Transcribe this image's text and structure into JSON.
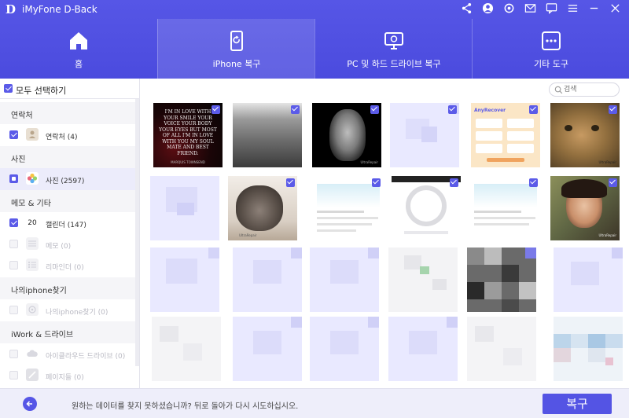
{
  "app": {
    "logo": "D",
    "title": "iMyFone D-Back"
  },
  "titlebar_icons": [
    "share-icon",
    "account-icon",
    "settings-icon",
    "mail-icon",
    "feedback-icon",
    "menu-icon",
    "minimize-icon",
    "close-icon"
  ],
  "nav": {
    "tabs": [
      {
        "label": "홈",
        "icon": "home-icon",
        "active": false
      },
      {
        "label": "iPhone 복구",
        "icon": "phone-recovery-icon",
        "active": true
      },
      {
        "label": "PC 및 하드 드라이브 복구",
        "icon": "pc-recovery-icon",
        "active": false
      },
      {
        "label": "기타 도구",
        "icon": "more-tools-icon",
        "active": false
      }
    ]
  },
  "sidebar": {
    "select_all": "모두 선택하기",
    "categories": [
      {
        "title": "연락처",
        "items": [
          {
            "label": "연락처 (4)",
            "state": "checked"
          }
        ]
      },
      {
        "title": "사진",
        "items": [
          {
            "label": "사진 (2597)",
            "state": "partial"
          }
        ]
      },
      {
        "title": "메모 & 기타",
        "items": [
          {
            "label": "캘린더 (147)",
            "state": "checked",
            "icon_text": "20"
          },
          {
            "label": "메모 (0)",
            "state": "disabled"
          },
          {
            "label": "리마인더 (0)",
            "state": "disabled"
          }
        ]
      },
      {
        "title": "나의iphone찾기",
        "items": [
          {
            "label": "나의iphone찾기 (0)",
            "state": "disabled"
          }
        ]
      },
      {
        "title": "iWork & 드라이브",
        "items": [
          {
            "label": "아이클라우드 드라이브 (0)",
            "state": "disabled"
          },
          {
            "label": "페이지들 (0)",
            "state": "disabled"
          }
        ]
      }
    ]
  },
  "search": {
    "placeholder": "검색"
  },
  "photos": {
    "poster_text": "I'M IN LOVE WITH YOUR SMILE YOUR VOICE YOUR BODY YOUR EYES BUT MOST OF ALL I'M IN LOVE WITH YOU MY SOUL MATE AND BEST FRIEND.",
    "poster_sub": "MARQUIS TOWNSEND",
    "watermark": "UltraRepair",
    "app_title": "AnyRecover"
  },
  "footer": {
    "hint": "원하는 데이터를 찾지 못하셨습니까? 뒤로 돌아가 다시 시도하십시오.",
    "recover_label": "복구",
    "back_icon": "back-arrow-icon"
  },
  "colors": {
    "accent": "#5656e6",
    "placeholder": "#e9e9ff"
  }
}
